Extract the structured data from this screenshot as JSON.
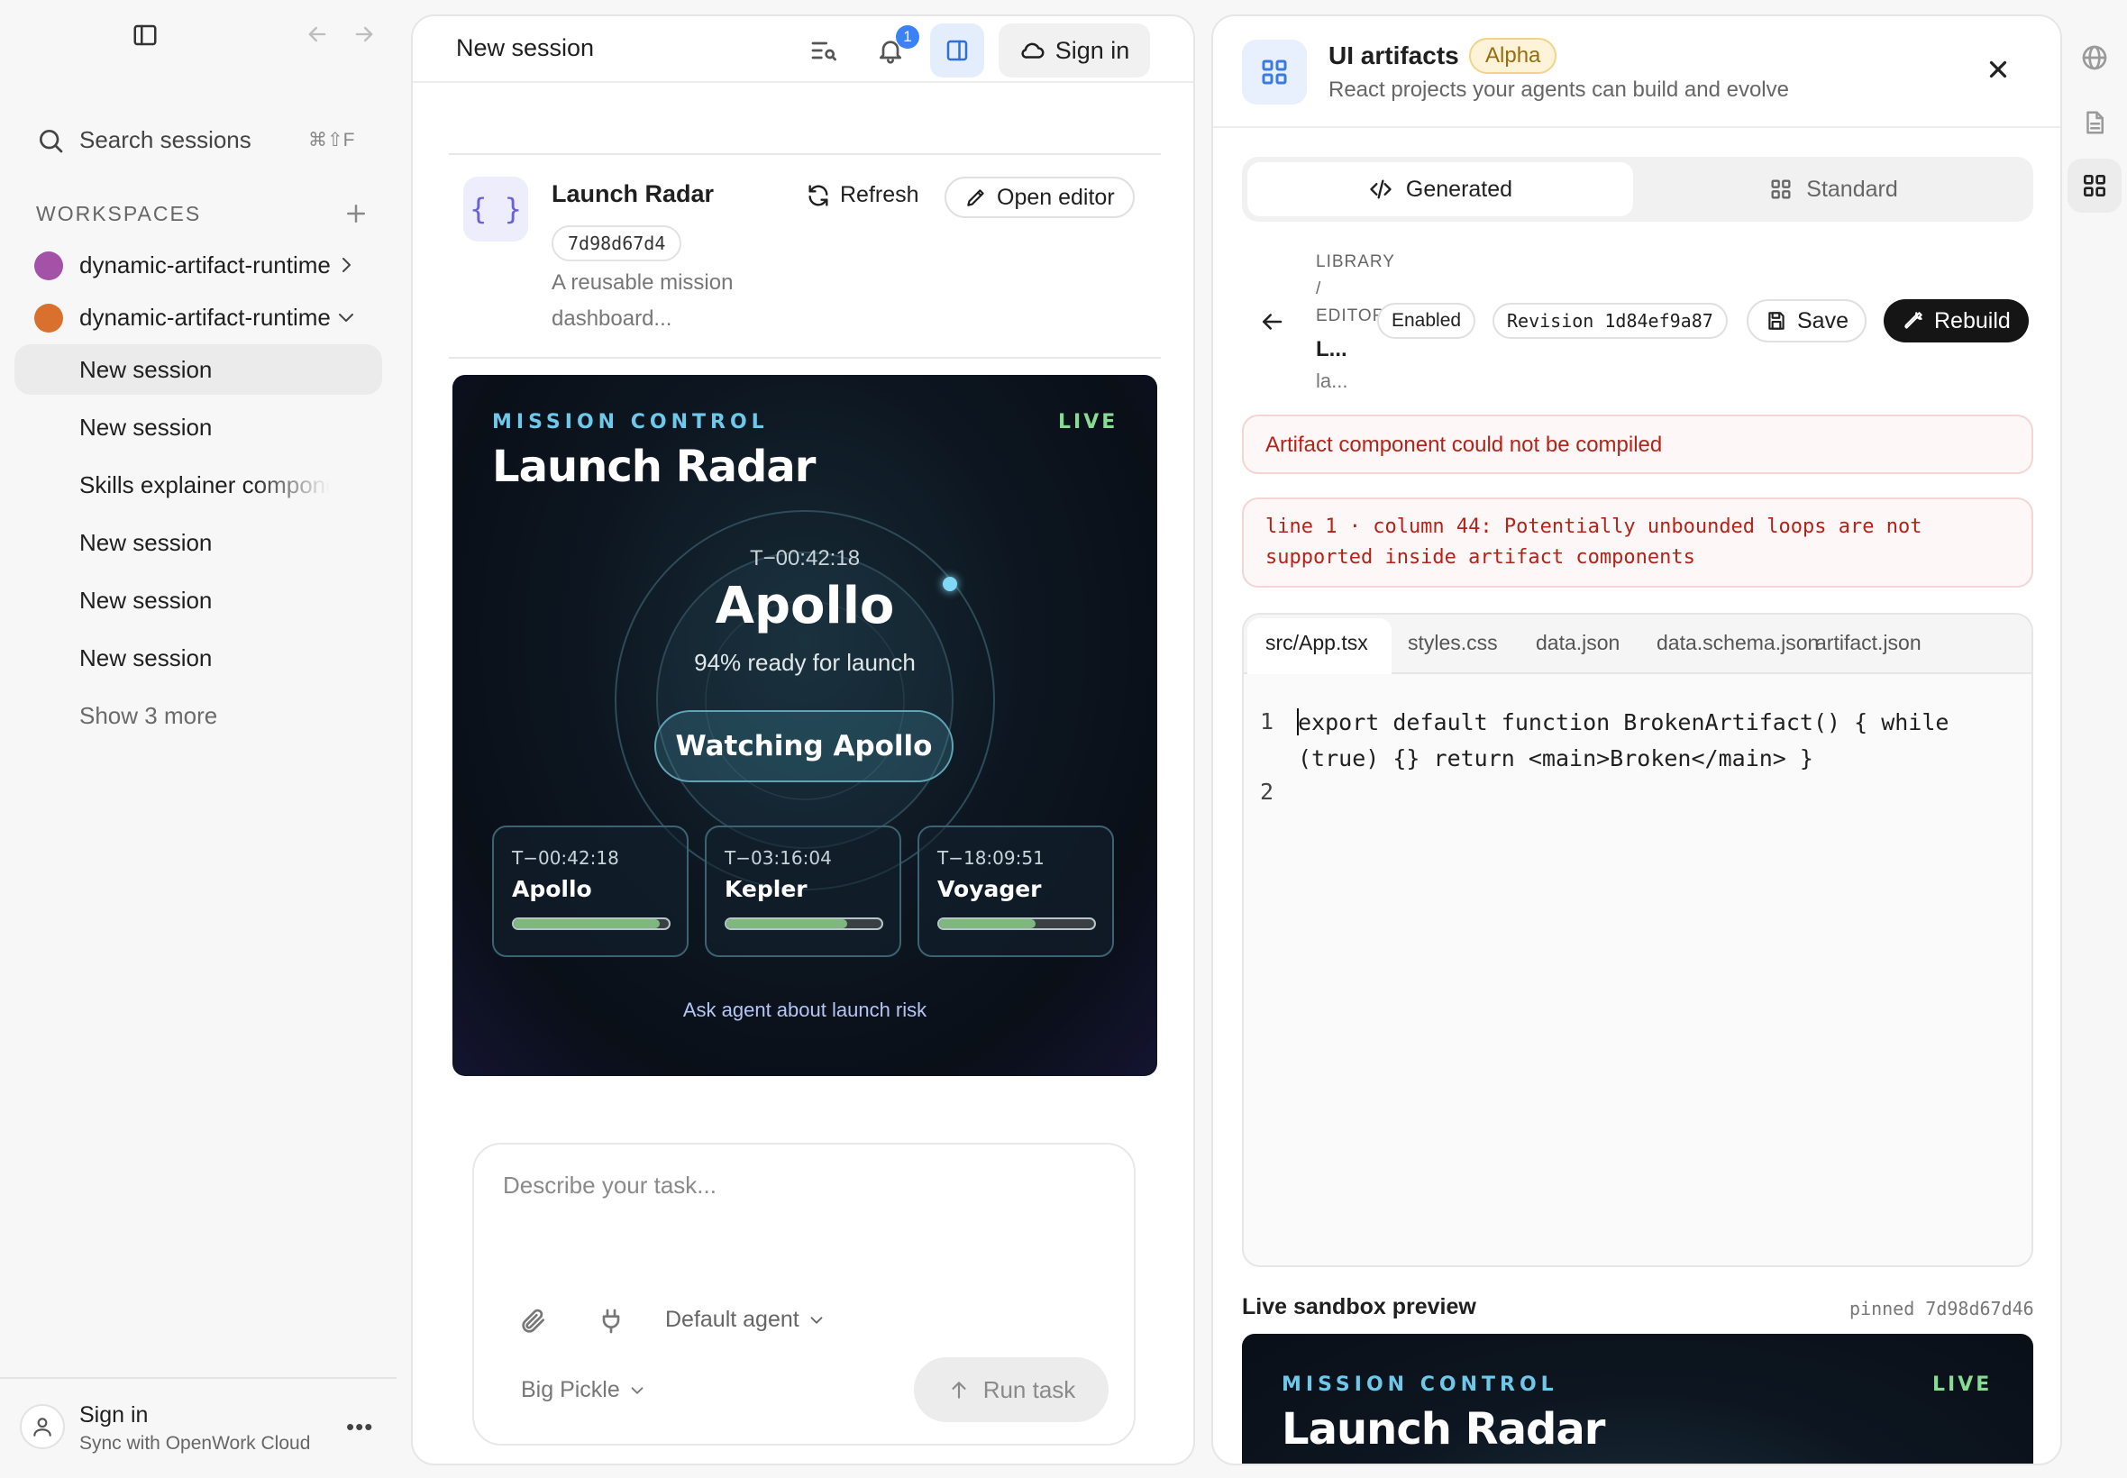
{
  "sidebar": {
    "search_label": "Search sessions",
    "search_shortcut": "⌘⇧F",
    "workspaces_heading": "WORKSPACES",
    "workspaces": [
      {
        "name": "dynamic-artifact-runtime",
        "color": "#a352a8",
        "expanded": false
      },
      {
        "name": "dynamic-artifact-runtime",
        "color": "#d9702e",
        "expanded": true
      }
    ],
    "sessions": [
      "New session",
      "New session",
      "Skills explainer component",
      "New session",
      "New session",
      "New session"
    ],
    "show_more": "Show 3 more",
    "account": {
      "title": "Sign in",
      "subtitle": "Sync with OpenWork Cloud"
    }
  },
  "session": {
    "title": "New session",
    "notification_count": "1",
    "sign_in_label": "Sign in",
    "artifact": {
      "name": "Launch Radar",
      "hash": "7d98d67d4",
      "desc_line1": "A reusable mission",
      "desc_line2": "dashboard...",
      "refresh_label": "Refresh",
      "open_editor_label": "Open editor"
    },
    "mission": {
      "eyebrow": "MISSION CONTROL",
      "live": "LIVE",
      "title": "Launch Radar",
      "countdown": "T−00:42:18",
      "focus": "Apollo",
      "ready_text": "94% ready for launch",
      "watch_button": "Watching Apollo",
      "missions": [
        {
          "t": "T−00:42:18",
          "name": "Apollo",
          "progress": 0.94
        },
        {
          "t": "T−03:16:04",
          "name": "Kepler",
          "progress": 0.78
        },
        {
          "t": "T−18:09:51",
          "name": "Voyager",
          "progress": 0.62
        }
      ],
      "ask_link": "Ask agent about launch risk"
    },
    "composer": {
      "placeholder": "Describe your task...",
      "agent": "Default agent",
      "model": "Big Pickle",
      "run_label": "Run task"
    }
  },
  "artifacts_panel": {
    "title": "UI artifacts",
    "badge": "Alpha",
    "subtitle": "React projects your agents can build and evolve",
    "tabs": [
      "Generated",
      "Standard"
    ],
    "breadcrumb": {
      "library": "LIBRARY",
      "sep": "/",
      "editor": "EDITOR",
      "name": "L...",
      "sub": "la..."
    },
    "status_chip": "Enabled",
    "revision_chip": "Revision 1d84ef9a87",
    "save_label": "Save",
    "rebuild_label": "Rebuild",
    "error_title": "Artifact component could not be compiled",
    "error_detail_line1": "line 1 · column 44: Potentially unbounded loops are not",
    "error_detail_line2": "supported inside artifact components",
    "file_tabs": [
      "src/App.tsx",
      "styles.css",
      "data.json",
      "data.schema.json",
      "artifact.json"
    ],
    "code": {
      "line1_num": "1",
      "line1a": "export default function BrokenArtifact() { while",
      "line1b": "(true) {} return <main>Broken</main> }",
      "line2_num": "2"
    },
    "preview_label": "Live sandbox preview",
    "pinned": "pinned 7d98d67d46",
    "preview": {
      "eyebrow": "MISSION CONTROL",
      "live": "LIVE",
      "title": "Launch Radar"
    }
  }
}
